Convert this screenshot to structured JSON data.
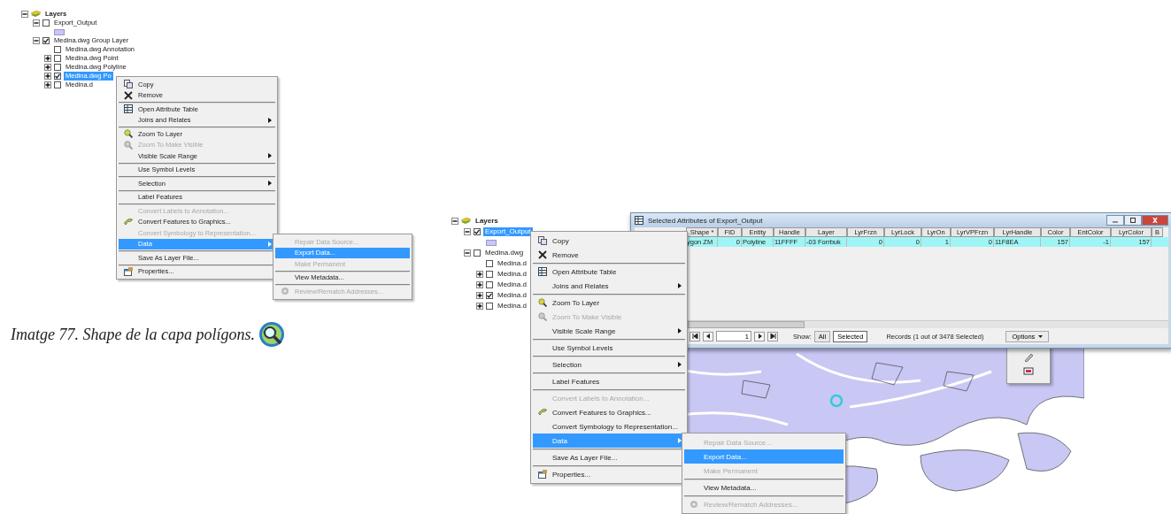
{
  "figures": [
    {
      "tree": {
        "kind": "root",
        "label": "Layers",
        "expanded": true,
        "children": [
          {
            "kind": "layer",
            "label": "Export_Output",
            "checked": false,
            "selected": false,
            "expanded": true,
            "children": [
              {
                "kind": "swatch"
              }
            ]
          },
          {
            "kind": "layer",
            "label": "Medina.dwg Group Layer",
            "checked": true,
            "selected": false,
            "expanded": true,
            "children": [
              {
                "kind": "layer",
                "label": "Medina.dwg Annotation",
                "checked": false,
                "selected": false
              },
              {
                "kind": "layer",
                "label": "Medina.dwg Point",
                "checked": false,
                "selected": false,
                "expanded": false
              },
              {
                "kind": "layer",
                "label": "Medina.dwg Polyline",
                "checked": false,
                "selected": false,
                "expanded": false
              },
              {
                "kind": "layer",
                "label": "Medina.dwg Po",
                "checked": true,
                "selected": true,
                "expanded": false
              },
              {
                "kind": "layer",
                "label": "Medina.d",
                "checked": false,
                "selected": false,
                "expanded": false
              }
            ]
          }
        ]
      },
      "context_menu": [
        {
          "kind": "copy",
          "label": "Copy",
          "submenu": false,
          "disabled": false,
          "selected": false,
          "separator_above": false
        },
        {
          "kind": "remove",
          "label": "Remove",
          "submenu": false,
          "disabled": false,
          "selected": false,
          "separator_above": false
        },
        {
          "kind": "table",
          "label": "Open Attribute Table",
          "submenu": false,
          "disabled": false,
          "selected": false,
          "separator_above": true
        },
        {
          "kind": "plain",
          "label": "Joins and Relates",
          "submenu": true,
          "disabled": false,
          "selected": false,
          "separator_above": false
        },
        {
          "kind": "zoom-layer",
          "label": "Zoom To Layer",
          "submenu": false,
          "disabled": false,
          "selected": false,
          "separator_above": true
        },
        {
          "kind": "zoom-visible",
          "label": "Zoom To Make Visible",
          "submenu": false,
          "disabled": true,
          "selected": false,
          "separator_above": false
        },
        {
          "kind": "plain",
          "label": "Visible Scale Range",
          "submenu": true,
          "disabled": false,
          "selected": false,
          "separator_above": false
        },
        {
          "kind": "plain",
          "label": "Use Symbol Levels",
          "submenu": false,
          "disabled": false,
          "selected": false,
          "separator_above": true
        },
        {
          "kind": "plain",
          "label": "Selection",
          "submenu": true,
          "disabled": false,
          "selected": false,
          "separator_above": true
        },
        {
          "kind": "plain",
          "label": "Label Features",
          "submenu": false,
          "disabled": false,
          "selected": false,
          "separator_above": true
        },
        {
          "kind": "plain",
          "label": "Convert Labels to Annotation...",
          "submenu": false,
          "disabled": true,
          "selected": false,
          "separator_above": true
        },
        {
          "kind": "graphics",
          "label": "Convert Features to Graphics...",
          "submenu": false,
          "disabled": false,
          "selected": false,
          "separator_above": false
        },
        {
          "kind": "plain",
          "label": "Convert Symbology to Representation...",
          "submenu": false,
          "disabled": true,
          "selected": false,
          "separator_above": false
        },
        {
          "kind": "plain",
          "label": "Data",
          "submenu": true,
          "disabled": false,
          "selected": true,
          "separator_above": false
        },
        {
          "kind": "plain",
          "label": "Save As Layer File...",
          "submenu": false,
          "disabled": false,
          "selected": false,
          "separator_above": true
        },
        {
          "kind": "properties",
          "label": "Properties...",
          "submenu": false,
          "disabled": false,
          "selected": false,
          "separator_above": true
        }
      ],
      "submenu": [
        {
          "kind": "plain",
          "label": "Repair Data Source...",
          "disabled": true,
          "selected": false,
          "separator_above": false
        },
        {
          "kind": "plain",
          "label": "Export Data...",
          "disabled": false,
          "selected": true,
          "separator_above": false
        },
        {
          "kind": "plain",
          "label": "Make Permanent",
          "disabled": true,
          "selected": false,
          "separator_above": false
        },
        {
          "kind": "plain",
          "label": "View Metadata...",
          "disabled": false,
          "selected": false,
          "separator_above": true
        },
        {
          "kind": "review",
          "label": "Review/Rematch Addresses...",
          "disabled": true,
          "selected": false,
          "separator_above": true
        }
      ]
    },
    {
      "tree": {
        "kind": "root",
        "label": "Layers",
        "expanded": true,
        "children": [
          {
            "kind": "layer",
            "label": "Export_Output",
            "checked": true,
            "selected": true,
            "expanded": true,
            "children": [
              {
                "kind": "swatch"
              }
            ]
          },
          {
            "kind": "layer",
            "label": "Medina.dwg",
            "checked": false,
            "selected": false,
            "expanded": true,
            "children": [
              {
                "kind": "layer",
                "label": "Medina.d",
                "checked": false,
                "selected": false
              },
              {
                "kind": "layer",
                "label": "Medina.d",
                "checked": false,
                "selected": false,
                "expanded": false
              },
              {
                "kind": "layer",
                "label": "Medina.d",
                "checked": false,
                "selected": false,
                "expanded": false
              },
              {
                "kind": "layer",
                "label": "Medina.d",
                "checked": true,
                "selected": false,
                "expanded": false
              },
              {
                "kind": "layer",
                "label": "Medina.d",
                "checked": false,
                "selected": false,
                "expanded": false
              }
            ]
          }
        ]
      },
      "attribute_window": {
        "title": "Selected Attributes of Export_Output",
        "columns": [
          "Shape *",
          "FID",
          "Entity",
          "Handle",
          "Layer",
          "LyrFrzn",
          "LyrLock",
          "LyrOn",
          "LyrVPFrzn",
          "LyrHandle",
          "Color",
          "EntColor",
          "LyrColor",
          "B"
        ],
        "rows": [
          {
            "selected": true,
            "cells": [
              "ygon ZM",
              "0",
              "Polyline",
              "11FFFF",
              "-03 Forrbuk",
              "0",
              "0",
              "1",
              "0",
              "11F8EA",
              "157",
              "-1",
              "157",
              ""
            ]
          }
        ],
        "record": "1",
        "show_label": "Show:",
        "show_buttons": [
          {
            "label": "All",
            "selected": false
          },
          {
            "label": "Selected",
            "selected": true
          }
        ],
        "records": "Records (1 out of 3478 Selected)",
        "options": "Options"
      },
      "context_menu": [
        {
          "kind": "copy",
          "label": "Copy",
          "submenu": false,
          "disabled": false,
          "selected": false,
          "separator_above": false
        },
        {
          "kind": "remove",
          "label": "Remove",
          "submenu": false,
          "disabled": false,
          "selected": false,
          "separator_above": false
        },
        {
          "kind": "table",
          "label": "Open Attribute Table",
          "submenu": false,
          "disabled": false,
          "selected": false,
          "separator_above": true
        },
        {
          "kind": "plain",
          "label": "Joins and Relates",
          "submenu": true,
          "disabled": false,
          "selected": false,
          "separator_above": false
        },
        {
          "kind": "zoom-layer",
          "label": "Zoom To Layer",
          "submenu": false,
          "disabled": false,
          "selected": false,
          "separator_above": true
        },
        {
          "kind": "zoom-visible",
          "label": "Zoom To Make Visible",
          "submenu": false,
          "disabled": true,
          "selected": false,
          "separator_above": false
        },
        {
          "kind": "plain",
          "label": "Visible Scale Range",
          "submenu": true,
          "disabled": false,
          "selected": false,
          "separator_above": false
        },
        {
          "kind": "plain",
          "label": "Use Symbol Levels",
          "submenu": false,
          "disabled": false,
          "selected": false,
          "separator_above": true
        },
        {
          "kind": "plain",
          "label": "Selection",
          "submenu": true,
          "disabled": false,
          "selected": false,
          "separator_above": true
        },
        {
          "kind": "plain",
          "label": "Label Features",
          "submenu": false,
          "disabled": false,
          "selected": false,
          "separator_above": true
        },
        {
          "kind": "plain",
          "label": "Convert Labels to Annotation...",
          "submenu": false,
          "disabled": true,
          "selected": false,
          "separator_above": true
        },
        {
          "kind": "graphics",
          "label": "Convert Features to Graphics...",
          "submenu": false,
          "disabled": false,
          "selected": false,
          "separator_above": false
        },
        {
          "kind": "plain",
          "label": "Convert Symbology to Representation...",
          "submenu": false,
          "disabled": false,
          "selected": false,
          "separator_above": false
        },
        {
          "kind": "plain",
          "label": "Data",
          "submenu": true,
          "disabled": false,
          "selected": true,
          "separator_above": false
        },
        {
          "kind": "plain",
          "label": "Save As Layer File...",
          "submenu": false,
          "disabled": false,
          "selected": false,
          "separator_above": true
        },
        {
          "kind": "properties",
          "label": "Properties...",
          "submenu": false,
          "disabled": false,
          "selected": false,
          "separator_above": true
        }
      ],
      "submenu": [
        {
          "kind": "plain",
          "label": "Repair Data Source...",
          "disabled": true,
          "selected": false,
          "separator_above": false
        },
        {
          "kind": "plain",
          "label": "Export Data...",
          "disabled": false,
          "selected": true,
          "separator_above": false
        },
        {
          "kind": "plain",
          "label": "Make Permanent",
          "disabled": true,
          "selected": false,
          "separator_above": false
        },
        {
          "kind": "plain",
          "label": "View Metadata...",
          "disabled": false,
          "selected": false,
          "separator_above": true
        },
        {
          "kind": "review",
          "label": "Review/Rematch Addresses...",
          "disabled": true,
          "selected": false,
          "separator_above": true
        }
      ]
    }
  ],
  "caption": "Imatge 77. Shape de la capa polígons."
}
